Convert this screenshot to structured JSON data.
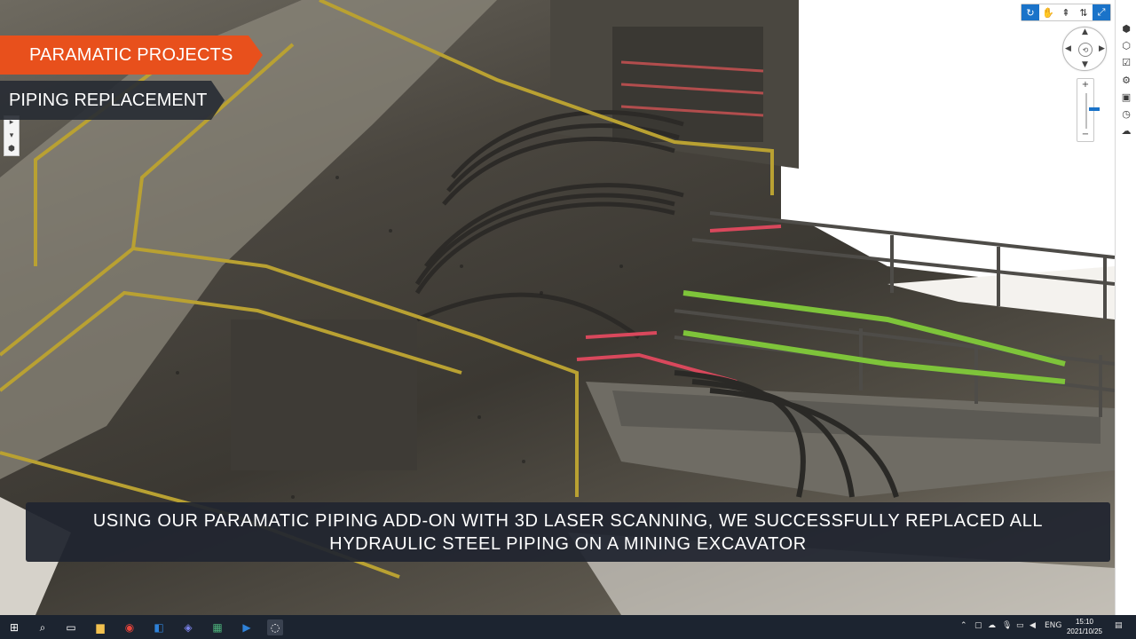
{
  "banners": {
    "project": "PARAMATIC PROJECTS",
    "subtitle": "PIPING REPLACEMENT"
  },
  "caption": {
    "line1": "USING OUR PARAMATIC PIPING ADD-ON WITH 3D LASER SCANNING, WE SUCCESSFULLY REPLACED ALL",
    "line2": "HYDRAULIC STEEL PIPING ON A MINING EXCAVATOR"
  },
  "viewer": {
    "toolbar": [
      {
        "name": "orbit-icon",
        "active": true
      },
      {
        "name": "pan-hand-icon",
        "active": false
      },
      {
        "name": "walk-icon",
        "active": false
      },
      {
        "name": "fly-icon",
        "active": false
      },
      {
        "name": "fullscreen-icon",
        "active": true
      }
    ],
    "zoom_level_fraction": 0.55,
    "right_strip_icons": [
      "cube-icon",
      "layers-icon",
      "check-icon",
      "settings-icon",
      "image-icon",
      "clock-icon",
      "cloud-icon"
    ]
  },
  "taskbar": {
    "language": "ENG",
    "time": "15:10",
    "date": "2021/10/25",
    "apps": [
      "start-icon",
      "search-icon",
      "task-view-icon",
      "file-explorer-icon",
      "chrome-icon",
      "outlook-icon",
      "teams-icon",
      "excel-icon",
      "app-icon",
      "obs-icon"
    ]
  },
  "colors": {
    "banner_orange": "#e8501c",
    "banner_dark": "#282c34",
    "caption_bg": "#212530",
    "accent_blue": "#1a73c9",
    "taskbar": "#1c2430"
  }
}
